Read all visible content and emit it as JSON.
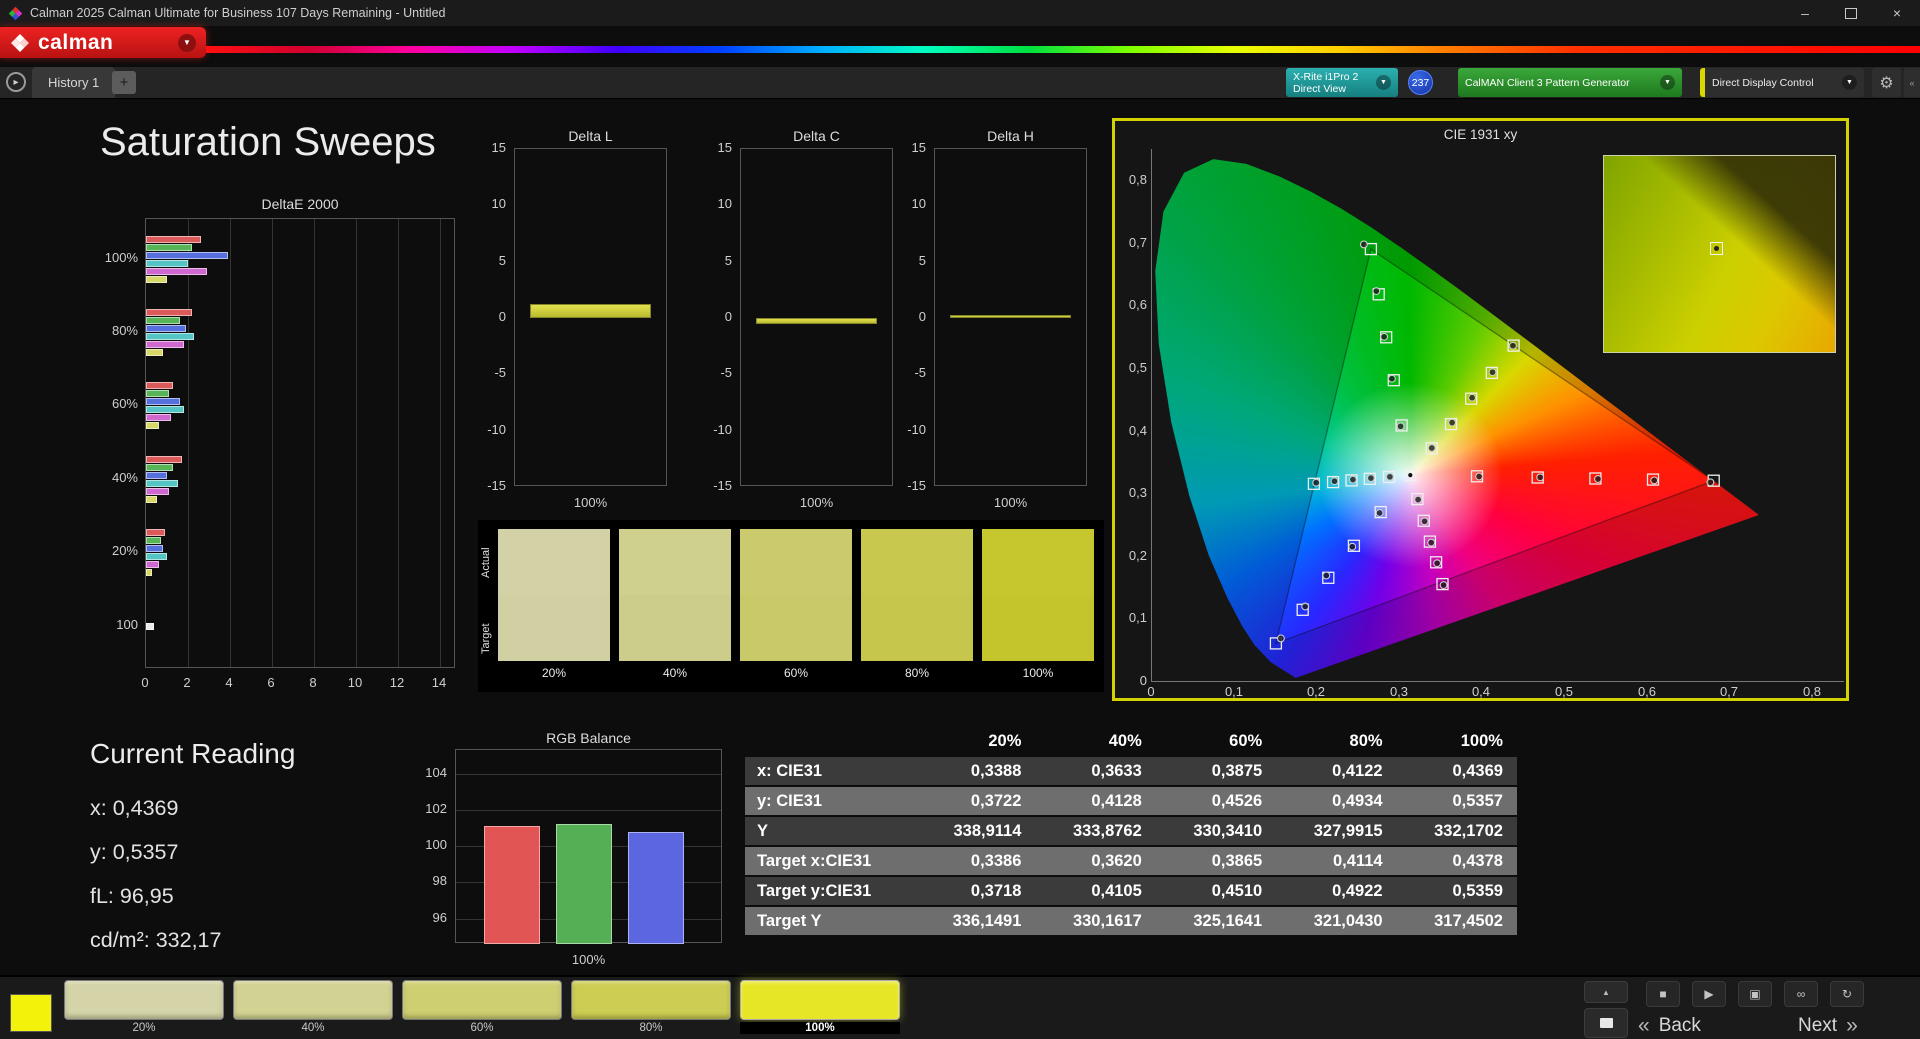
{
  "titlebar": {
    "title": "Calman 2025 Calman Ultimate for Business 107 Days Remaining  - Untitled"
  },
  "brand": {
    "logo_text": "calman"
  },
  "tabbar": {
    "tabs": [
      {
        "label": "History 1"
      }
    ]
  },
  "toolbar": {
    "meter_line1": "X-Rite i1Pro 2",
    "meter_line2": "Direct View",
    "meter_badge": "237",
    "pattern_label": "CalMAN Client 3 Pattern Generator",
    "display_label": "Direct Display Control"
  },
  "icons": {
    "caret_down": "▼",
    "gear": "⚙",
    "history_nav": "▸",
    "plus": "+",
    "up_arrow": "▲",
    "minimize": "–",
    "close": "×",
    "back_chevron": "«",
    "next_chevron": "»"
  },
  "page_title": "Saturation Sweeps",
  "current_reading": {
    "title": "Current Reading",
    "lines": [
      "x: 0,4369",
      "y: 0,5357",
      "fL: 96,95",
      "cd/m²: 332,17"
    ]
  },
  "colorchecker": {
    "row_labels": [
      "Actual",
      "Target"
    ],
    "labels": [
      "20%",
      "40%",
      "60%",
      "80%",
      "100%"
    ],
    "actual": [
      "#d2d2a6",
      "#cfcf8e",
      "#cbcb6d",
      "#c8c84f",
      "#c6c62f"
    ],
    "target": [
      "#d0d0a3",
      "#cdcd8b",
      "#c9c96a",
      "#c6c64d",
      "#c4c42d"
    ]
  },
  "table": {
    "columns": [
      "20%",
      "40%",
      "60%",
      "80%",
      "100%"
    ],
    "rows": [
      {
        "label": "x: CIE31",
        "values": [
          "0,3388",
          "0,3633",
          "0,3875",
          "0,4122",
          "0,4369"
        ]
      },
      {
        "label": "y: CIE31",
        "values": [
          "0,3722",
          "0,4128",
          "0,4526",
          "0,4934",
          "0,5357"
        ]
      },
      {
        "label": "Y",
        "values": [
          "338,9114",
          "333,8762",
          "330,3410",
          "327,9915",
          "332,1702"
        ]
      },
      {
        "label": "Target x:CIE31",
        "values": [
          "0,3386",
          "0,3620",
          "0,3865",
          "0,4114",
          "0,4378"
        ]
      },
      {
        "label": "Target y:CIE31",
        "values": [
          "0,3718",
          "0,4105",
          "0,4510",
          "0,4922",
          "0,5359"
        ]
      },
      {
        "label": "Target Y",
        "values": [
          "336,1491",
          "330,1617",
          "325,1641",
          "321,0430",
          "317,4502"
        ]
      }
    ]
  },
  "patch_bar": {
    "patches": [
      {
        "label": "20%",
        "color": "#d4d4a8"
      },
      {
        "label": "40%",
        "color": "#d2d292"
      },
      {
        "label": "60%",
        "color": "#cecf71"
      },
      {
        "label": "80%",
        "color": "#cccd52"
      },
      {
        "label": "100%",
        "color": "#e6e626"
      }
    ],
    "selected_index": 4,
    "preview_color": "#f2f20a"
  },
  "controls": {
    "back": "Back",
    "next": "Next",
    "bottom_icons": [
      {
        "name": "stop-button",
        "glyph": "■"
      },
      {
        "name": "play-button",
        "glyph": "▶"
      },
      {
        "name": "save-button",
        "glyph": "▣"
      },
      {
        "name": "link-button",
        "glyph": "∞"
      },
      {
        "name": "refresh-button",
        "glyph": "↻"
      }
    ]
  },
  "chart_data": [
    {
      "id": "deltae2000",
      "type": "bar",
      "title": "DeltaE 2000",
      "orientation": "horizontal",
      "xlim": [
        0,
        14
      ],
      "xticks": [
        0,
        2,
        4,
        6,
        8,
        10,
        12,
        14
      ],
      "groups": [
        {
          "label": "100%",
          "bars": [
            {
              "color": "#db5a5a",
              "value": 2.6
            },
            {
              "color": "#57b457",
              "value": 2.2
            },
            {
              "color": "#5570dd",
              "value": 3.9
            },
            {
              "color": "#55c4c4",
              "value": 2.0
            },
            {
              "color": "#cf68cf",
              "value": 2.9
            },
            {
              "color": "#d8d868",
              "value": 1.0
            }
          ]
        },
        {
          "label": "80%",
          "bars": [
            {
              "color": "#db5a5a",
              "value": 2.2
            },
            {
              "color": "#57b457",
              "value": 1.6
            },
            {
              "color": "#5570dd",
              "value": 1.9
            },
            {
              "color": "#55c4c4",
              "value": 2.3
            },
            {
              "color": "#cf68cf",
              "value": 1.8
            },
            {
              "color": "#d8d868",
              "value": 0.8
            }
          ]
        },
        {
          "label": "60%",
          "bars": [
            {
              "color": "#db5a5a",
              "value": 1.3
            },
            {
              "color": "#57b457",
              "value": 1.1
            },
            {
              "color": "#5570dd",
              "value": 1.6
            },
            {
              "color": "#55c4c4",
              "value": 1.8
            },
            {
              "color": "#cf68cf",
              "value": 1.2
            },
            {
              "color": "#d8d868",
              "value": 0.6
            }
          ]
        },
        {
          "label": "40%",
          "bars": [
            {
              "color": "#db5a5a",
              "value": 1.7
            },
            {
              "color": "#57b457",
              "value": 1.3
            },
            {
              "color": "#5570dd",
              "value": 1.0
            },
            {
              "color": "#55c4c4",
              "value": 1.5
            },
            {
              "color": "#cf68cf",
              "value": 1.1
            },
            {
              "color": "#d8d868",
              "value": 0.5
            }
          ]
        },
        {
          "label": "20%",
          "bars": [
            {
              "color": "#db5a5a",
              "value": 0.9
            },
            {
              "color": "#57b457",
              "value": 0.7
            },
            {
              "color": "#5570dd",
              "value": 0.8
            },
            {
              "color": "#55c4c4",
              "value": 1.0
            },
            {
              "color": "#cf68cf",
              "value": 0.6
            },
            {
              "color": "#d8d868",
              "value": 0.3
            }
          ]
        },
        {
          "label": "100",
          "bars": [
            {
              "color": "#ececec",
              "value": 0.4
            }
          ]
        }
      ]
    },
    {
      "id": "deltaL",
      "type": "bar",
      "title": "Delta L",
      "ylim": [
        -15,
        15
      ],
      "yticks": [
        15,
        10,
        5,
        0,
        -5,
        -10,
        -15
      ],
      "xlabel": "100%",
      "value": 1.2,
      "bar_color": "#d2d23a"
    },
    {
      "id": "deltaC",
      "type": "bar",
      "title": "Delta C",
      "ylim": [
        -15,
        15
      ],
      "yticks": [
        15,
        10,
        5,
        0,
        -5,
        -10,
        -15
      ],
      "xlabel": "100%",
      "value": -0.55,
      "bar_color": "#d2d23a"
    },
    {
      "id": "deltaH",
      "type": "bar",
      "title": "Delta H",
      "ylim": [
        -15,
        15
      ],
      "yticks": [
        15,
        10,
        5,
        0,
        -5,
        -10,
        -15
      ],
      "xlabel": "100%",
      "value": 0.2,
      "bar_color": "#d2d23a"
    },
    {
      "id": "rgbBalance",
      "type": "bar",
      "title": "RGB Balance",
      "ylim": [
        94.6,
        105.3
      ],
      "yticks": [
        104,
        102,
        100,
        98,
        96
      ],
      "xlabel": "100%",
      "categories": [
        "red",
        "green",
        "blue"
      ],
      "values": [
        101.1,
        101.2,
        100.8
      ],
      "colors": [
        "#e25555",
        "#55b055",
        "#5b66e0"
      ]
    },
    {
      "id": "cie1931",
      "type": "scatter",
      "title": "CIE 1931 xy",
      "x_range": [
        0,
        0.8378
      ],
      "y_range": [
        0,
        0.85
      ],
      "tick_labels": [
        "0",
        "0,1",
        "0,2",
        "0,3",
        "0,4",
        "0,5",
        "0,6",
        "0,7",
        "0,8"
      ],
      "white_point": [
        0.3127,
        0.329
      ],
      "gamut_triangle": {
        "name": "P3",
        "r": [
          0.68,
          0.32
        ],
        "g": [
          0.265,
          0.69
        ],
        "b": [
          0.15,
          0.06
        ]
      },
      "spectral_locus": [
        [
          0.1741,
          0.005
        ],
        [
          0.144,
          0.0297
        ],
        [
          0.1241,
          0.0578
        ],
        [
          0.1096,
          0.0868
        ],
        [
          0.0913,
          0.1327
        ],
        [
          0.0687,
          0.2007
        ],
        [
          0.0454,
          0.295
        ],
        [
          0.0235,
          0.4127
        ],
        [
          0.0082,
          0.5384
        ],
        [
          0.0039,
          0.6548
        ],
        [
          0.0139,
          0.7502
        ],
        [
          0.0389,
          0.812
        ],
        [
          0.0743,
          0.8338
        ],
        [
          0.1142,
          0.8262
        ],
        [
          0.1547,
          0.8059
        ],
        [
          0.1929,
          0.7816
        ],
        [
          0.2296,
          0.7543
        ],
        [
          0.2658,
          0.7243
        ],
        [
          0.3016,
          0.6923
        ],
        [
          0.3373,
          0.6589
        ],
        [
          0.3731,
          0.6245
        ],
        [
          0.4087,
          0.5896
        ],
        [
          0.4441,
          0.5547
        ],
        [
          0.4788,
          0.5202
        ],
        [
          0.5125,
          0.4866
        ],
        [
          0.5448,
          0.4544
        ],
        [
          0.5752,
          0.4242
        ],
        [
          0.6029,
          0.3965
        ],
        [
          0.627,
          0.3725
        ],
        [
          0.6482,
          0.3514
        ],
        [
          0.6658,
          0.334
        ],
        [
          0.6915,
          0.3083
        ],
        [
          0.7079,
          0.292
        ],
        [
          0.719,
          0.2809
        ],
        [
          0.726,
          0.274
        ],
        [
          0.7347,
          0.2653
        ]
      ],
      "sweeps": [
        {
          "name": "red",
          "targets": [
            [
              0.3935,
              0.327
            ],
            [
              0.467,
              0.3252
            ],
            [
              0.5368,
              0.3235
            ],
            [
              0.6065,
              0.3218
            ],
            [
              0.68,
              0.32
            ]
          ],
          "measured": [
            [
              0.396,
              0.3268
            ],
            [
              0.47,
              0.3255
            ],
            [
              0.54,
              0.3228
            ],
            [
              0.608,
              0.3205
            ],
            [
              0.676,
              0.3175
            ]
          ]
        },
        {
          "name": "green",
          "targets": [
            [
              0.3022,
              0.4084
            ],
            [
              0.2927,
              0.4806
            ],
            [
              0.2836,
              0.5492
            ],
            [
              0.2745,
              0.6178
            ],
            [
              0.265,
              0.69
            ]
          ],
          "measured": [
            [
              0.301,
              0.407
            ],
            [
              0.2905,
              0.483
            ],
            [
              0.281,
              0.55
            ],
            [
              0.2715,
              0.623
            ],
            [
              0.2565,
              0.6975
            ]
          ]
        },
        {
          "name": "blue",
          "targets": [
            [
              0.2769,
              0.2698
            ],
            [
              0.2444,
              0.216
            ],
            [
              0.2135,
              0.1649
            ],
            [
              0.1825,
              0.1138
            ],
            [
              0.15,
              0.06
            ]
          ],
          "measured": [
            [
              0.2755,
              0.2685
            ],
            [
              0.2425,
              0.2145
            ],
            [
              0.211,
              0.1685
            ],
            [
              0.1855,
              0.119
            ],
            [
              0.156,
              0.068
            ]
          ]
        },
        {
          "name": "cyan",
          "targets": [
            [
              0.287,
              0.3259
            ],
            [
              0.2637,
              0.3231
            ],
            [
              0.2415,
              0.3205
            ],
            [
              0.2193,
              0.3178
            ],
            [
              0.196,
              0.315
            ]
          ],
          "measured": [
            [
              0.288,
              0.3262
            ],
            [
              0.265,
              0.3242
            ],
            [
              0.2432,
              0.3218
            ],
            [
              0.221,
              0.3192
            ],
            [
              0.1988,
              0.3168
            ]
          ]
        },
        {
          "name": "magenta",
          "targets": [
            [
              0.3213,
              0.2907
            ],
            [
              0.3291,
              0.2559
            ],
            [
              0.3365,
              0.2228
            ],
            [
              0.3439,
              0.1897
            ],
            [
              0.3517,
              0.1549
            ]
          ],
          "measured": [
            [
              0.3222,
              0.2898
            ],
            [
              0.33,
              0.2552
            ],
            [
              0.338,
              0.2212
            ],
            [
              0.3452,
              0.1882
            ],
            [
              0.353,
              0.1532
            ]
          ]
        },
        {
          "name": "yellow",
          "targets": [
            [
              0.3386,
              0.3718
            ],
            [
              0.362,
              0.4105
            ],
            [
              0.3865,
              0.451
            ],
            [
              0.4114,
              0.4922
            ],
            [
              0.4378,
              0.5359
            ]
          ],
          "measured": [
            [
              0.3388,
              0.3722
            ],
            [
              0.3633,
              0.4128
            ],
            [
              0.3875,
              0.4526
            ],
            [
              0.4122,
              0.4934
            ],
            [
              0.4369,
              0.5357
            ]
          ]
        }
      ]
    }
  ]
}
